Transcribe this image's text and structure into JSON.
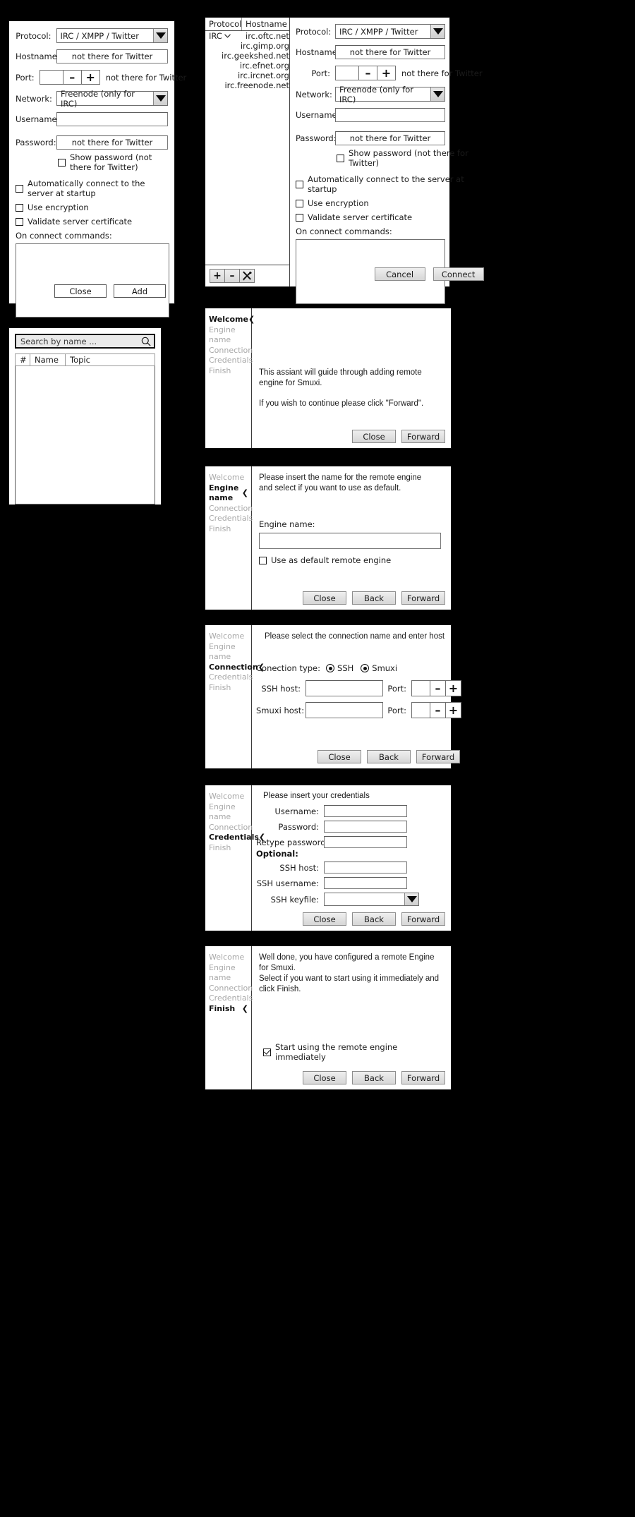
{
  "server_dialog": {
    "protocol_label": "Protocol:",
    "protocol_value": "IRC / XMPP / Twitter",
    "hostname_label": "Hostname:",
    "hostname_value": "not there for Twitter",
    "port_label": "Port:",
    "port_value": "",
    "port_hint": "not there for Twitter",
    "minus": "–",
    "plus": "+",
    "network_label": "Network:",
    "network_value": "Freenode (only for IRC)",
    "username_label": "Username:",
    "username_value": "",
    "password_label": "Password:",
    "password_value": "not there for Twitter",
    "show_password_label": "Show password (not there for Twitter)",
    "autoconnect_label": "Automatically connect to the server at startup",
    "encryption_label": "Use encryption",
    "validate_label": "Validate server certificate",
    "oncommands_label": "On connect commands:",
    "oncommands_value": "",
    "close_label": "Close",
    "add_label": "Add"
  },
  "connect_dialog": {
    "table": {
      "columns": [
        "Protocol",
        "Hostname"
      ],
      "protocol_cell": "IRC",
      "protocol_expander": "chevron-down-icon",
      "hosts": [
        "irc.oftc.net",
        "irc.gimp.org",
        "irc.geekshed.net",
        "irc.efnet.org",
        "irc.ircnet.org",
        "irc.freenode.net"
      ]
    },
    "toolbar": {
      "add": "+",
      "remove": "–",
      "edit": "tools-icon"
    },
    "form": {
      "protocol_label": "Protocol:",
      "protocol_value": "IRC / XMPP / Twitter",
      "hostname_label": "Hostname:",
      "hostname_value": "not there for Twitter",
      "port_label": "Port:",
      "port_value": "",
      "port_hint": "not there for Twitter",
      "minus": "–",
      "plus": "+",
      "network_label": "Network:",
      "network_value": "Freenode (only for IRC)",
      "username_label": "Username:",
      "username_value": "",
      "password_label": "Password:",
      "password_value": "not there for Twitter",
      "show_password_label": "Show password (not there for Twitter)",
      "autoconnect_label": "Automatically connect to the server at startup",
      "encryption_label": "Use encryption",
      "validate_label": "Validate server certificate",
      "oncommands_label": "On connect commands:",
      "oncommands_value": ""
    },
    "cancel_label": "Cancel",
    "connect_label": "Connect"
  },
  "channel_list": {
    "search_placeholder": "Search by name ...",
    "search_value": "Search by name ...",
    "search_icon": "search-icon",
    "columns": [
      "#",
      "Name",
      "Topic"
    ],
    "rows": []
  },
  "wizard": {
    "steps": [
      "Welcome",
      "Engine name",
      "Connection",
      "Credentials",
      "Finish"
    ],
    "chevron": "❮",
    "buttons": {
      "close": "Close",
      "back": "Back",
      "forward": "Forward"
    },
    "welcome": {
      "active_step": 0,
      "line1": "This assiant will guide through adding remote engine for Smuxi.",
      "line2": "If you wish to continue please click \"Forward\"."
    },
    "engine_name": {
      "active_step": 1,
      "line1": "Please insert the name for the remote engine",
      "line2": "and select if you want to use as default.",
      "field_label": "Engine name:",
      "field_value": "",
      "default_checkbox": "Use as default remote engine"
    },
    "connection": {
      "active_step": 2,
      "heading": "Please select the connection name and enter host",
      "conn_type_label": "Conection type:",
      "option_ssh": "SSH",
      "option_smuxi": "Smuxi",
      "ssh_host_label": "SSH host:",
      "ssh_host_value": "",
      "ssh_port_label": "Port:",
      "ssh_port_value": "",
      "smuxi_host_label": "Smuxi host:",
      "smuxi_host_value": "",
      "smuxi_port_label": "Port:",
      "smuxi_port_value": "",
      "minus": "–",
      "plus": "+"
    },
    "credentials": {
      "active_step": 3,
      "heading": "Please insert your credentials",
      "username_label": "Username:",
      "username_value": "",
      "password_label": "Password:",
      "password_value": "",
      "retype_label": "Retype password:",
      "retype_value": "",
      "optional_label": "Optional:",
      "ssh_host_label": "SSH host:",
      "ssh_host_value": "",
      "ssh_username_label": "SSH username:",
      "ssh_username_value": "",
      "ssh_keyfile_label": "SSH keyfile:",
      "ssh_keyfile_value": ""
    },
    "finish": {
      "active_step": 4,
      "line1": "Well done, you have configured a remote Engine for Smuxi.",
      "line2": "Select if you want to start using it immediately and click Finish.",
      "start_checkbox": "Start using the remote engine immediately",
      "start_checked": true
    }
  },
  "colors": {
    "background": "#000000",
    "surface": "#ffffff",
    "text": "#1b1b1b",
    "muted_text": "#a8a8a8",
    "border": "#6f6f6f",
    "button_face": "#e2e2e2"
  }
}
